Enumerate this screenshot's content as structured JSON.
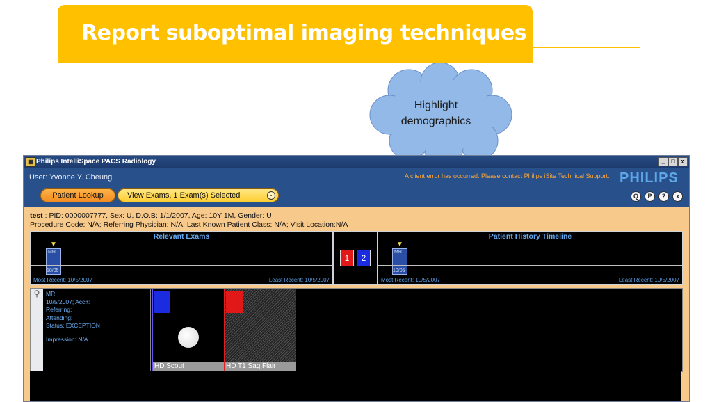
{
  "slide": {
    "title": "Report suboptimal imaging techniques",
    "callout": "Highlight demographics",
    "accent_color": "#FFC000",
    "cloud_color": "#92B9E8"
  },
  "window": {
    "title": "Philips IntelliSpace PACS Radiology",
    "controls": [
      "_",
      "□",
      "x"
    ]
  },
  "header": {
    "user": "User: Yvonne Y. Cheung",
    "error_message": "A client error has occurred. Please contact Philips iSite Technical Support.",
    "logo": "PHILIPS",
    "icons": [
      {
        "name": "q-icon",
        "glyph": "Q"
      },
      {
        "name": "p-icon",
        "glyph": "P"
      },
      {
        "name": "help-icon",
        "glyph": "?"
      },
      {
        "name": "close-icon",
        "glyph": "x"
      }
    ],
    "tabs": {
      "patient_lookup": "Patient Lookup",
      "view_exams": "View Exams, 1 Exam(s) Selected"
    }
  },
  "patient": {
    "name": "test",
    "line1_rest": " : PID: 0000007777, Sex: U, D.O.B: 1/1/2007, Age: 10Y 1M, Gender: U",
    "line2": "Procedure Code: N/A; Referring Physician: N/A; Last Known Patient Class: N/A; Visit Location:N/A"
  },
  "relevant_exams": {
    "title": "Relevant Exams",
    "mark_modality": "MR",
    "mark_date": "10/05",
    "most_recent": "Most Recent: 10/5/2007",
    "least_recent": "Least Recent: 10/5/2007"
  },
  "compare": {
    "slot1": "1",
    "slot2": "2",
    "slot1_color": "#e01818",
    "slot2_color": "#1a2be0"
  },
  "history_timeline": {
    "title": "Patient History Timeline",
    "mark_modality": "MR",
    "mark_date": "10/05",
    "most_recent": "Most Recent: 10/5/2007",
    "least_recent": "Least Recent: 10/5/2007"
  },
  "exam_details": {
    "lines": [
      "MR;",
      "10/5/2007; Acc#:",
      "Referring:",
      "Attending:",
      "Status: EXCEPTION"
    ],
    "impression": "Impression: N/A"
  },
  "series": [
    {
      "label": "HD Scout",
      "marker_color": "#1a2be0",
      "border_color": "#6a4ff0"
    },
    {
      "label": "HD T1 Sag Flair",
      "marker_color": "#e01818",
      "border_color": "#e02020"
    }
  ]
}
